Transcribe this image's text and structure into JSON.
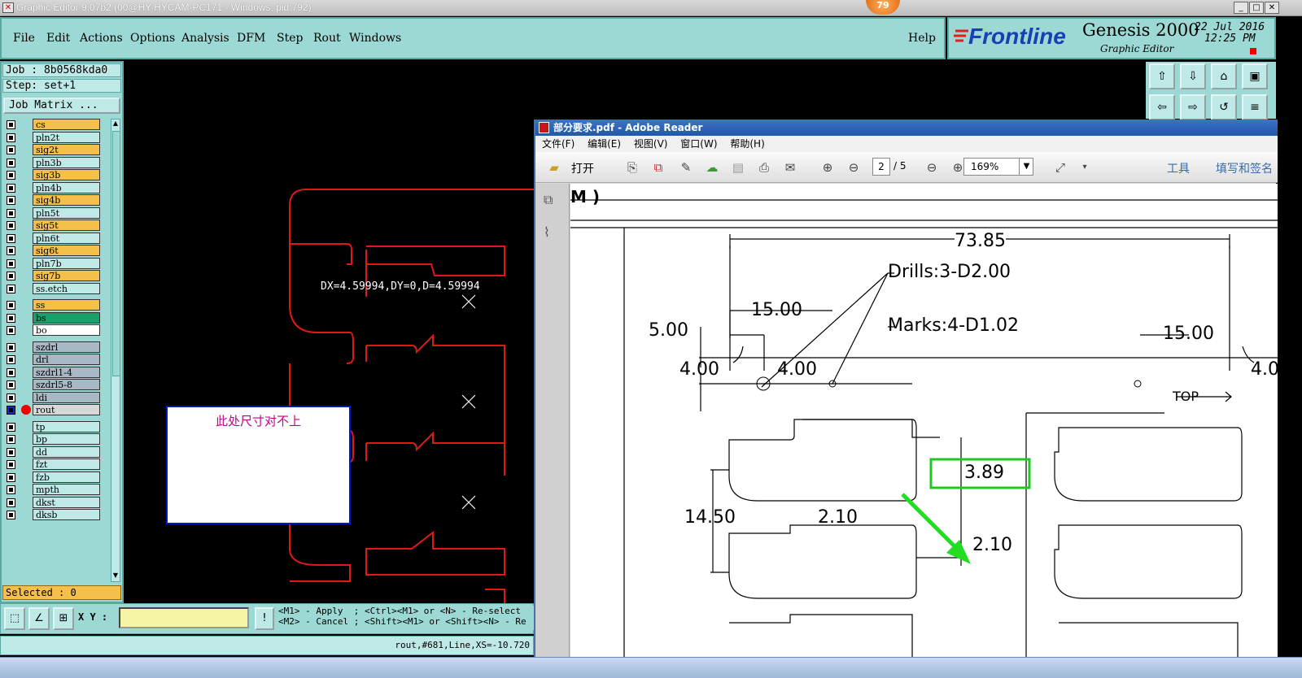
{
  "window": {
    "title": "Graphic Editor 9.07b2 (00@HY-HYCAM-PC171 - Windows, pid:792)",
    "badge": "79"
  },
  "menu": {
    "items": [
      "File",
      "Edit",
      "Actions",
      "Options",
      "Analysis",
      "DFM",
      "Step",
      "Rout",
      "Windows"
    ],
    "help": "Help"
  },
  "brand": {
    "logo": "Frontline",
    "product": "Genesis 2000",
    "subtitle": "Graphic Editor",
    "date": "22 Jul 2016",
    "time": "12:25 PM"
  },
  "job": {
    "job_label": "Job : 8b0568kda0",
    "step_label": "Step: set+1",
    "matrix_button": "Job Matrix ...",
    "selected_label": "Selected : 0"
  },
  "layers": [
    {
      "name": "cs",
      "color": "#f5c04a"
    },
    {
      "name": "pln2t",
      "color": "#bfe9e6"
    },
    {
      "name": "sig2t",
      "color": "#f5c04a"
    },
    {
      "name": "pln3b",
      "color": "#bfe9e6"
    },
    {
      "name": "sig3b",
      "color": "#f5c04a"
    },
    {
      "name": "pln4b",
      "color": "#bfe9e6"
    },
    {
      "name": "sig4b",
      "color": "#f5c04a"
    },
    {
      "name": "pln5t",
      "color": "#bfe9e6"
    },
    {
      "name": "sig5t",
      "color": "#f5c04a"
    },
    {
      "name": "pln6t",
      "color": "#bfe9e6"
    },
    {
      "name": "sig6t",
      "color": "#f5c04a"
    },
    {
      "name": "pln7b",
      "color": "#bfe9e6"
    },
    {
      "name": "sig7b",
      "color": "#f5c04a"
    },
    {
      "name": "ss.etch",
      "color": "#bfe9e6"
    },
    {
      "name": "ss",
      "color": "#f5c04a"
    },
    {
      "name": "bs",
      "color": "#1aa06a"
    },
    {
      "name": "bo",
      "color": "#ffffff"
    },
    {
      "name": "szdrl",
      "color": "#a8b8c4"
    },
    {
      "name": "drl",
      "color": "#a8b8c4"
    },
    {
      "name": "szdrl1-4",
      "color": "#a8b8c4"
    },
    {
      "name": "szdrl5-8",
      "color": "#a8b8c4"
    },
    {
      "name": "ldi",
      "color": "#a8b8c4"
    },
    {
      "name": "rout",
      "color": "#d8d8d8"
    },
    {
      "name": "tp",
      "color": "#bfe9e6"
    },
    {
      "name": "bp",
      "color": "#bfe9e6"
    },
    {
      "name": "dd",
      "color": "#bfe9e6"
    },
    {
      "name": "fzt",
      "color": "#bfe9e6"
    },
    {
      "name": "fzb",
      "color": "#bfe9e6"
    },
    {
      "name": "mpth",
      "color": "#bfe9e6"
    },
    {
      "name": "dkst",
      "color": "#bfe9e6"
    },
    {
      "name": "dksb",
      "color": "#bfe9e6"
    }
  ],
  "canvas": {
    "measure": "DX=4.59994,DY=0,D=4.59994",
    "note": "此处尺寸对不上"
  },
  "bottom": {
    "xy_label": "X Y :",
    "xy_value": "",
    "hint": "<M1> - Apply  ; <Ctrl><M1> or <N> - Re-select\n<M2> - Cancel ; <Shift><M1> or <Shift><N> - Re",
    "status": "rout,#681,Line,XS=-10.720"
  },
  "adobe": {
    "title": "部分要求.pdf - Adobe Reader",
    "menu": [
      "文件(F)",
      "编辑(E)",
      "视图(V)",
      "窗口(W)",
      "帮助(H)"
    ],
    "open_label": "打开",
    "page_current": "2",
    "page_total": "/ 5",
    "zoom": "169%",
    "tools": "工具",
    "sign": "填写和签名"
  },
  "pdf": {
    "header_fragment": "M )",
    "dim_width": "73.85",
    "drills": "Drills:3-D2.00",
    "marks": "Marks:4-D1.02",
    "dim_15a": "15.00",
    "dim_15b": "15.00",
    "dim_5": "5.00",
    "dim_4a": "4.00",
    "dim_4b": "4.00",
    "dim_4c": "4.0",
    "top_label": "TOP",
    "dim_389": "3.89",
    "dim_1450": "14.50",
    "dim_210a": "2.10",
    "dim_210b": "2.10"
  }
}
